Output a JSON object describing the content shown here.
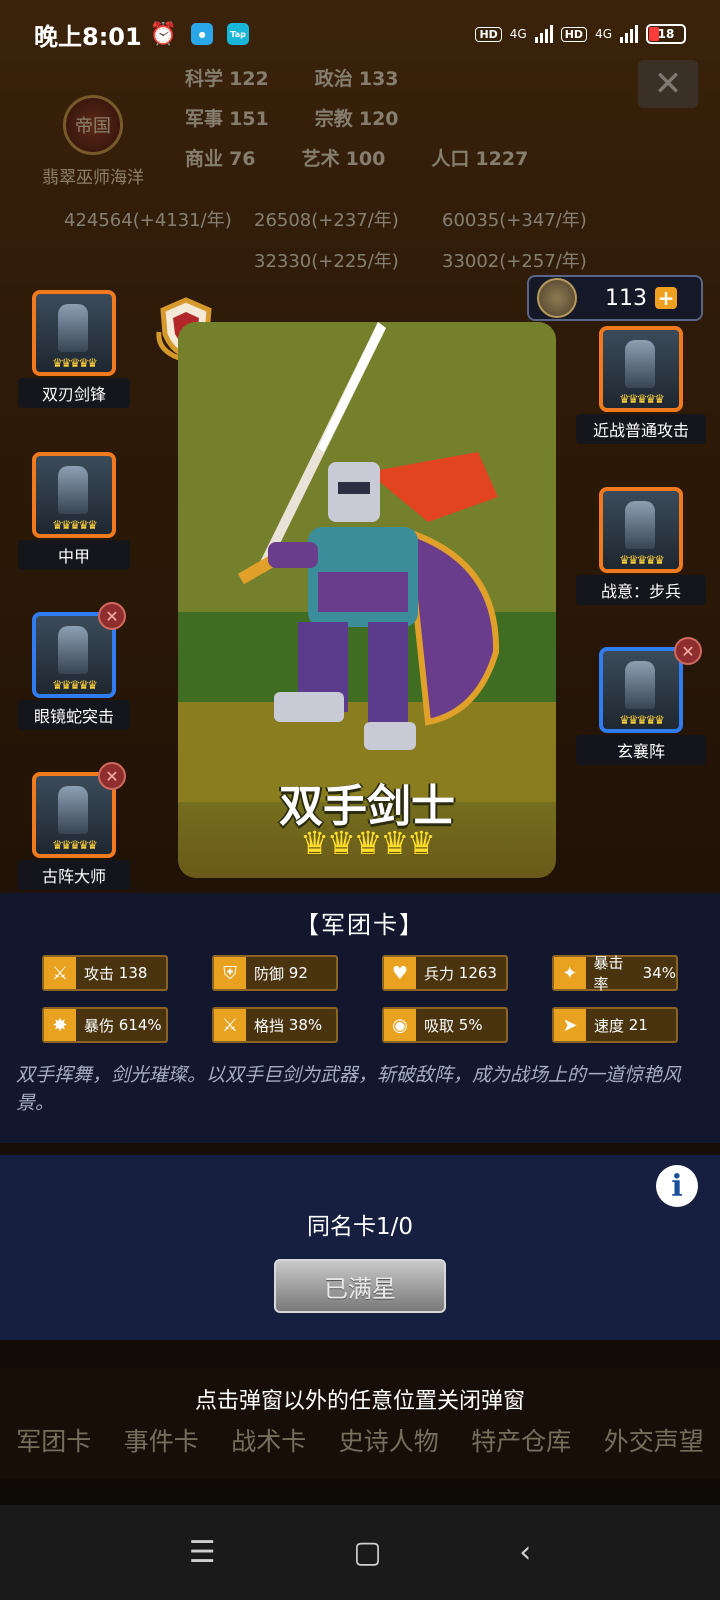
{
  "status_bar": {
    "time": "晚上8:01",
    "tap_label": "Tap",
    "network1": "4G",
    "network2": "4G",
    "hd": "HD",
    "battery": "18"
  },
  "background": {
    "empire_badge": "帝国",
    "empire_name": "翡翠巫师海洋",
    "resources": [
      {
        "label": "科学",
        "value": "122"
      },
      {
        "label": "政治",
        "value": "133"
      },
      {
        "label": "军事",
        "value": "151"
      },
      {
        "label": "宗教",
        "value": "120"
      },
      {
        "label": "商业",
        "value": "76"
      },
      {
        "label": "艺术",
        "value": "100"
      },
      {
        "label": "人口",
        "value": "1227"
      }
    ],
    "stocks": [
      "424564(+4131/年)",
      "26508(+237/年)",
      "60035(+347/年)",
      "32330(+225/年)",
      "33002(+257/年)"
    ],
    "bottom_nav": [
      "军团卡",
      "事件卡",
      "战术卡",
      "史诗人物",
      "特产仓库",
      "外交声望"
    ]
  },
  "currency": {
    "value": "113",
    "plus": "+"
  },
  "left_cards": [
    {
      "label": "双刃剑锋",
      "border": "orange"
    },
    {
      "label": "中甲",
      "border": "orange"
    },
    {
      "label": "眼镜蛇突击",
      "border": "blue"
    },
    {
      "label": "古阵大师",
      "border": "orange"
    }
  ],
  "right_cards": [
    {
      "label": "近战普通攻击",
      "border": "orange"
    },
    {
      "label": "战意：步兵",
      "border": "orange"
    },
    {
      "label": "玄襄阵",
      "border": "blue"
    }
  ],
  "main_card": {
    "name": "双手剑士",
    "stars": "♛♛♛♛♛"
  },
  "info": {
    "type": "【军团卡】",
    "stats": [
      {
        "icon": "sword-icon",
        "label": "攻击",
        "value": "138"
      },
      {
        "icon": "shield-icon",
        "label": "防御",
        "value": "92"
      },
      {
        "icon": "heart-icon",
        "label": "兵力",
        "value": "1263"
      },
      {
        "icon": "crit-icon",
        "label": "暴击率",
        "value": "34%"
      },
      {
        "icon": "burst-icon",
        "label": "暴伤",
        "value": "614%"
      },
      {
        "icon": "parry-icon",
        "label": "格挡",
        "value": "38%"
      },
      {
        "icon": "lifesteal-icon",
        "label": "吸取",
        "value": "5%"
      },
      {
        "icon": "boot-icon",
        "label": "速度",
        "value": "21"
      }
    ],
    "description": "双手挥舞，剑光璀璨。以双手巨剑为武器，斩破敌阵，成为战场上的一道惊艳风景。"
  },
  "duplicate": {
    "count": "同名卡1/0",
    "button": "已满星"
  },
  "hint": "点击弹窗以外的任意位置关闭弹窗",
  "nav": {
    "menu": "☰",
    "home": "▢",
    "back": "‹"
  },
  "colors": {
    "accent": "#e9a21f",
    "panel": "#121830",
    "orange_frame": "#f07a1d",
    "blue_frame": "#2f7df0"
  }
}
